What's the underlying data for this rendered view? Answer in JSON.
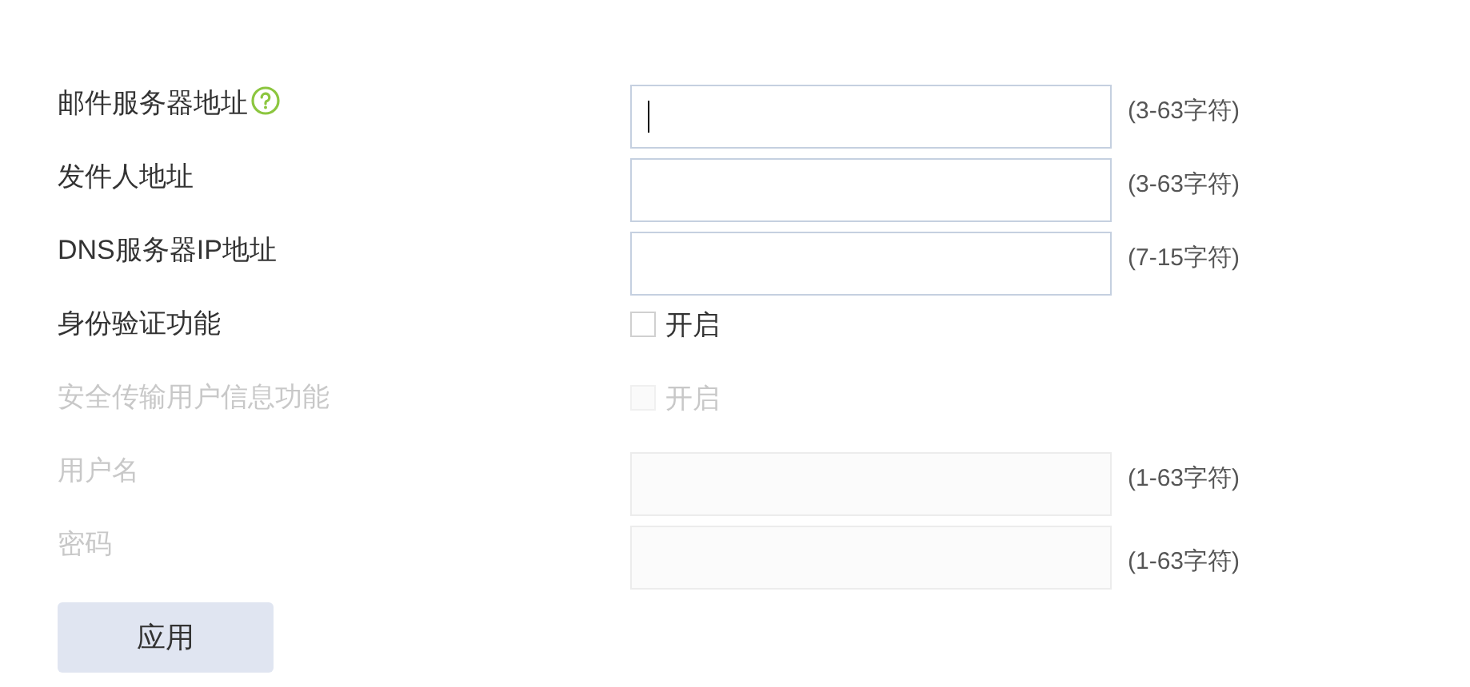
{
  "fields": [
    {
      "kind": "text",
      "label": "邮件服务器地址",
      "help": true,
      "disabled": false,
      "focused": true,
      "hint": "(3-63字符)"
    },
    {
      "kind": "text",
      "label": "发件人地址",
      "disabled": false,
      "hint": "(3-63字符)"
    },
    {
      "kind": "text",
      "label": "DNS服务器IP地址",
      "disabled": false,
      "hint": "(7-15字符)"
    },
    {
      "kind": "checkbox",
      "label": "身份验证功能",
      "disabled": false,
      "checked": false,
      "option": "开启"
    },
    {
      "kind": "checkbox",
      "label": "安全传输用户信息功能",
      "disabled": true,
      "checked": false,
      "option": "开启"
    },
    {
      "kind": "text",
      "label": "用户名",
      "disabled": true,
      "hint": "(1-63字符)"
    },
    {
      "kind": "text",
      "label": "密码",
      "disabled": true,
      "hint": "(1-63字符)"
    }
  ],
  "apply_button": "应用"
}
